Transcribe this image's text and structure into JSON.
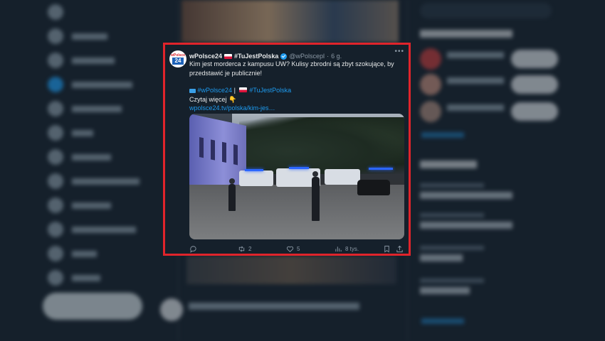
{
  "tweet": {
    "author_name": "wPolsce24",
    "author_hashtag": "#TuJestPolska",
    "handle": "@wPolscepl",
    "separator": "·",
    "time": "6 g.",
    "avatar": {
      "top_text": "wPolsce",
      "number_text": "24"
    },
    "text_line1": "Kim jest morderca z kampusu UW? Kulisy zbrodni są zbyt szokujące, by przedstawić je publicznie!",
    "hashtag1": "#wPolsce24",
    "pipe": "|",
    "hashtag2": "#TuJestPolska",
    "read_more": "Czytaj więcej",
    "finger_emoji": "👇",
    "link": "wpolsce24.tv/polska/kim-jes…",
    "more_icon": "ellipsis-icon",
    "actions": {
      "reply_count": "",
      "retweet_count": "2",
      "like_count": "5",
      "views_count": "8 tys."
    },
    "highlight_color": "#e0242b",
    "accent_color": "#1d9bf0"
  },
  "background": {
    "sidebar_labels": [
      "",
      "",
      "",
      "",
      "",
      "",
      "",
      "",
      "",
      "",
      "",
      ""
    ],
    "post_button": "",
    "search_placeholder": "",
    "who_to_follow_title": "",
    "trends_title": ""
  }
}
